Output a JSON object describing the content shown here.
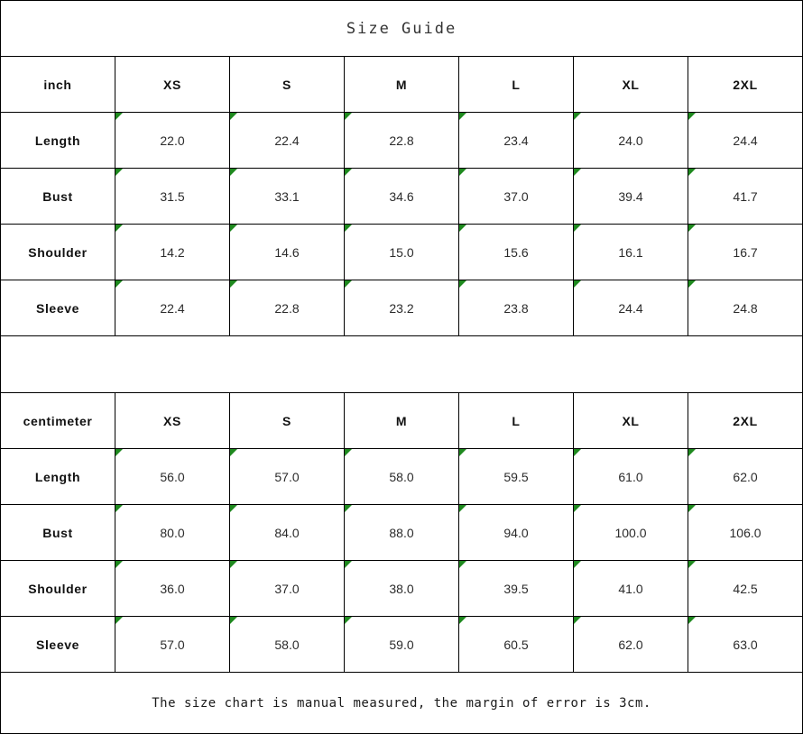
{
  "title": "Size Guide",
  "footer_note": "The size chart is manual measured, the margin of error is 3cm.",
  "marker_color": "#1f8a1f",
  "tables": [
    {
      "unit_label": "inch",
      "sizes": [
        "XS",
        "S",
        "M",
        "L",
        "XL",
        "2XL"
      ],
      "rows": [
        {
          "label": "Length",
          "values": [
            "22.0",
            "22.4",
            "22.8",
            "23.4",
            "24.0",
            "24.4"
          ]
        },
        {
          "label": "Bust",
          "values": [
            "31.5",
            "33.1",
            "34.6",
            "37.0",
            "39.4",
            "41.7"
          ]
        },
        {
          "label": "Shoulder",
          "values": [
            "14.2",
            "14.6",
            "15.0",
            "15.6",
            "16.1",
            "16.7"
          ]
        },
        {
          "label": "Sleeve",
          "values": [
            "22.4",
            "22.8",
            "23.2",
            "23.8",
            "24.4",
            "24.8"
          ]
        }
      ]
    },
    {
      "unit_label": "centimeter",
      "sizes": [
        "XS",
        "S",
        "M",
        "L",
        "XL",
        "2XL"
      ],
      "rows": [
        {
          "label": "Length",
          "values": [
            "56.0",
            "57.0",
            "58.0",
            "59.5",
            "61.0",
            "62.0"
          ]
        },
        {
          "label": "Bust",
          "values": [
            "80.0",
            "84.0",
            "88.0",
            "94.0",
            "100.0",
            "106.0"
          ]
        },
        {
          "label": "Shoulder",
          "values": [
            "36.0",
            "37.0",
            "38.0",
            "39.5",
            "41.0",
            "42.5"
          ]
        },
        {
          "label": "Sleeve",
          "values": [
            "57.0",
            "58.0",
            "59.0",
            "60.5",
            "62.0",
            "63.0"
          ]
        }
      ]
    }
  ]
}
